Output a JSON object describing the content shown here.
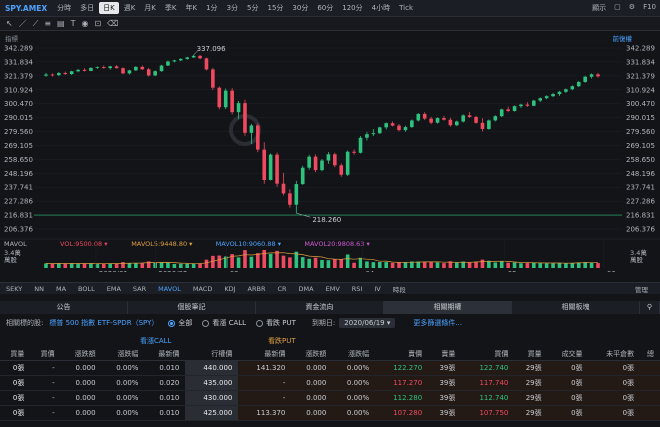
{
  "topbar": {
    "symbol": "SPY.AMEX",
    "periods": [
      "分時",
      "多日",
      "日K",
      "週K",
      "月K",
      "季K",
      "年K",
      "1分",
      "3分",
      "5分",
      "15分",
      "30分",
      "60分",
      "120分",
      "4小時",
      "Tick"
    ],
    "active_period": "日K",
    "right_items": [
      "顯示",
      "▢",
      "⚙",
      "F10"
    ]
  },
  "indicator_bar": {
    "left_label": "指標",
    "right_label": "前復權"
  },
  "chart_data": {
    "type": "candlestick",
    "price_ticks": [
      "342.289",
      "331.834",
      "321.379",
      "310.924",
      "300.470",
      "290.015",
      "279.560",
      "269.105",
      "258.650",
      "248.196",
      "237.741",
      "227.286",
      "216.831",
      "206.376"
    ],
    "ylim": [
      206.376,
      342.289
    ],
    "x_tick_labels": [
      "2020/01",
      "2020/02",
      "03",
      "04",
      "05",
      "06"
    ],
    "annotations": [
      {
        "label": "337.096",
        "value": 337.096
      },
      {
        "label": "218.260",
        "value": 218.26
      }
    ],
    "bars": [
      {
        "o": 321.5,
        "h": 323.6,
        "l": 320.7,
        "c": 322.4
      },
      {
        "o": 322.4,
        "h": 323.1,
        "l": 320.8,
        "c": 321.9
      },
      {
        "o": 321.9,
        "h": 324.3,
        "l": 321.2,
        "c": 323.5
      },
      {
        "o": 323.5,
        "h": 324.6,
        "l": 322.2,
        "c": 322.7
      },
      {
        "o": 322.7,
        "h": 325.2,
        "l": 322.1,
        "c": 324.8
      },
      {
        "o": 324.8,
        "h": 326.4,
        "l": 324.1,
        "c": 325.9
      },
      {
        "o": 325.9,
        "h": 327.1,
        "l": 324.6,
        "c": 325.1
      },
      {
        "o": 325.1,
        "h": 327.8,
        "l": 324.8,
        "c": 327.3
      },
      {
        "o": 327.3,
        "h": 328.5,
        "l": 326.6,
        "c": 327.9
      },
      {
        "o": 327.9,
        "h": 329.1,
        "l": 326.8,
        "c": 327.2
      },
      {
        "o": 327.2,
        "h": 328.9,
        "l": 326.1,
        "c": 328.5
      },
      {
        "o": 328.5,
        "h": 329.4,
        "l": 326.9,
        "c": 327.1
      },
      {
        "o": 327.1,
        "h": 327.8,
        "l": 322.6,
        "c": 323.2
      },
      {
        "o": 323.2,
        "h": 325.9,
        "l": 322.4,
        "c": 325.5
      },
      {
        "o": 325.5,
        "h": 328.7,
        "l": 325.1,
        "c": 328.1
      },
      {
        "o": 328.1,
        "h": 329.2,
        "l": 325.8,
        "c": 326.3
      },
      {
        "o": 326.3,
        "h": 327.4,
        "l": 320.9,
        "c": 321.7
      },
      {
        "o": 321.7,
        "h": 325.5,
        "l": 321.1,
        "c": 324.9
      },
      {
        "o": 324.9,
        "h": 329.6,
        "l": 324.5,
        "c": 329.1
      },
      {
        "o": 329.1,
        "h": 332.8,
        "l": 328.8,
        "c": 332.2
      },
      {
        "o": 332.2,
        "h": 333.4,
        "l": 331.5,
        "c": 333.0
      },
      {
        "o": 333.0,
        "h": 334.6,
        "l": 332.4,
        "c": 334.1
      },
      {
        "o": 334.1,
        "h": 335.7,
        "l": 333.4,
        "c": 335.2
      },
      {
        "o": 335.2,
        "h": 337.1,
        "l": 334.8,
        "c": 336.4
      },
      {
        "o": 336.4,
        "h": 337.0,
        "l": 333.9,
        "c": 334.5
      },
      {
        "o": 334.5,
        "h": 335.1,
        "l": 325.4,
        "c": 326.2
      },
      {
        "o": 326.2,
        "h": 327.3,
        "l": 310.7,
        "c": 312.5
      },
      {
        "o": 312.5,
        "h": 313.4,
        "l": 296.2,
        "c": 297.8
      },
      {
        "o": 297.8,
        "h": 311.9,
        "l": 296.4,
        "c": 310.3
      },
      {
        "o": 310.3,
        "h": 312.2,
        "l": 292.4,
        "c": 294.1
      },
      {
        "o": 294.1,
        "h": 302.6,
        "l": 288.8,
        "c": 300.9
      },
      {
        "o": 300.9,
        "h": 303.5,
        "l": 276.4,
        "c": 278.6
      },
      {
        "o": 278.6,
        "h": 285.3,
        "l": 270.2,
        "c": 284.1
      },
      {
        "o": 284.1,
        "h": 285.6,
        "l": 264.1,
        "c": 266.0
      },
      {
        "o": 266.0,
        "h": 271.5,
        "l": 240.3,
        "c": 243.2
      },
      {
        "o": 243.2,
        "h": 263.1,
        "l": 242.8,
        "c": 262.2
      },
      {
        "o": 262.2,
        "h": 263.8,
        "l": 238.1,
        "c": 240.4
      },
      {
        "o": 240.4,
        "h": 248.6,
        "l": 231.6,
        "c": 233.1
      },
      {
        "o": 233.1,
        "h": 236.2,
        "l": 222.4,
        "c": 224.6
      },
      {
        "o": 224.6,
        "h": 242.5,
        "l": 218.3,
        "c": 240.1
      },
      {
        "o": 240.1,
        "h": 253.8,
        "l": 239.5,
        "c": 252.4
      },
      {
        "o": 252.4,
        "h": 262.1,
        "l": 250.8,
        "c": 260.7
      },
      {
        "o": 260.7,
        "h": 262.4,
        "l": 249.1,
        "c": 250.6
      },
      {
        "o": 250.6,
        "h": 258.9,
        "l": 249.7,
        "c": 257.8
      },
      {
        "o": 257.8,
        "h": 264.1,
        "l": 255.3,
        "c": 262.5
      },
      {
        "o": 262.5,
        "h": 263.7,
        "l": 252.8,
        "c": 254.2
      },
      {
        "o": 254.2,
        "h": 255.6,
        "l": 245.6,
        "c": 247.1
      },
      {
        "o": 247.1,
        "h": 265.3,
        "l": 246.2,
        "c": 264.4
      },
      {
        "o": 264.4,
        "h": 266.2,
        "l": 262.1,
        "c": 263.6
      },
      {
        "o": 263.6,
        "h": 276.2,
        "l": 263.1,
        "c": 274.9
      },
      {
        "o": 274.9,
        "h": 279.3,
        "l": 272.8,
        "c": 277.6
      },
      {
        "o": 277.6,
        "h": 281.4,
        "l": 276.2,
        "c": 278.3
      },
      {
        "o": 278.3,
        "h": 283.2,
        "l": 277.8,
        "c": 282.7
      },
      {
        "o": 282.7,
        "h": 286.4,
        "l": 281.1,
        "c": 285.8
      },
      {
        "o": 285.8,
        "h": 287.1,
        "l": 283.4,
        "c": 284.0
      },
      {
        "o": 284.0,
        "h": 285.2,
        "l": 279.8,
        "c": 280.6
      },
      {
        "o": 280.6,
        "h": 283.9,
        "l": 279.4,
        "c": 282.9
      },
      {
        "o": 282.9,
        "h": 288.6,
        "l": 282.3,
        "c": 287.9
      },
      {
        "o": 287.9,
        "h": 293.4,
        "l": 287.1,
        "c": 292.8
      },
      {
        "o": 292.8,
        "h": 294.1,
        "l": 288.2,
        "c": 289.3
      },
      {
        "o": 289.3,
        "h": 290.6,
        "l": 285.1,
        "c": 286.2
      },
      {
        "o": 286.2,
        "h": 290.3,
        "l": 285.5,
        "c": 289.7
      },
      {
        "o": 289.7,
        "h": 291.2,
        "l": 287.8,
        "c": 288.4
      },
      {
        "o": 288.4,
        "h": 289.9,
        "l": 283.2,
        "c": 284.3
      },
      {
        "o": 284.3,
        "h": 287.8,
        "l": 283.6,
        "c": 287.1
      },
      {
        "o": 287.1,
        "h": 292.5,
        "l": 286.3,
        "c": 291.7
      },
      {
        "o": 291.7,
        "h": 294.2,
        "l": 289.8,
        "c": 290.5
      },
      {
        "o": 290.5,
        "h": 291.3,
        "l": 285.4,
        "c": 286.1
      },
      {
        "o": 286.1,
        "h": 289.5,
        "l": 279.7,
        "c": 281.5
      },
      {
        "o": 281.5,
        "h": 288.6,
        "l": 280.9,
        "c": 287.9
      },
      {
        "o": 287.9,
        "h": 291.8,
        "l": 287.2,
        "c": 291.1
      },
      {
        "o": 291.1,
        "h": 296.7,
        "l": 290.4,
        "c": 296.2
      },
      {
        "o": 296.2,
        "h": 298.3,
        "l": 294.1,
        "c": 295.0
      },
      {
        "o": 295.0,
        "h": 299.1,
        "l": 294.6,
        "c": 298.6
      },
      {
        "o": 298.6,
        "h": 300.4,
        "l": 297.2,
        "c": 299.8
      },
      {
        "o": 299.8,
        "h": 301.6,
        "l": 298.1,
        "c": 298.9
      },
      {
        "o": 298.9,
        "h": 303.4,
        "l": 298.6,
        "c": 302.8
      },
      {
        "o": 302.8,
        "h": 305.2,
        "l": 301.7,
        "c": 304.6
      },
      {
        "o": 304.6,
        "h": 306.8,
        "l": 303.9,
        "c": 306.1
      },
      {
        "o": 306.1,
        "h": 308.5,
        "l": 305.4,
        "c": 307.7
      },
      {
        "o": 307.7,
        "h": 310.1,
        "l": 306.2,
        "c": 309.4
      },
      {
        "o": 309.4,
        "h": 311.9,
        "l": 308.5,
        "c": 311.3
      },
      {
        "o": 311.3,
        "h": 314.2,
        "l": 310.6,
        "c": 313.6
      },
      {
        "o": 313.6,
        "h": 317.6,
        "l": 312.9,
        "c": 316.8
      },
      {
        "o": 316.8,
        "h": 321.4,
        "l": 316.1,
        "c": 320.7
      },
      {
        "o": 320.7,
        "h": 323.2,
        "l": 319.4,
        "c": 322.5
      },
      {
        "o": 322.5,
        "h": 323.6,
        "l": 320.1,
        "c": 321.0
      }
    ]
  },
  "volume": {
    "labels": [
      {
        "text": "MAVOL",
        "color": "#aeb3bb"
      },
      {
        "text": "VOL:9500.08 ▾",
        "color": "#ef4a5f"
      },
      {
        "text": "MAVOL5:9448.80 ▾",
        "color": "#e0a040"
      },
      {
        "text": "MAVOL10:9060.88 ▾",
        "color": "#4aa3ff"
      },
      {
        "text": "MAVOL20:9808.63 ▾",
        "color": "#d05ad0"
      }
    ],
    "left_tick": "3.4萬",
    "left_unit": "萬股",
    "right_tick": "3.4萬",
    "right_unit": "萬股"
  },
  "indicator_tabs": [
    "SEKY",
    "NN",
    "MA",
    "BOLL",
    "EMA",
    "SAR",
    "MAVOL",
    "MACD",
    "KDJ",
    "ARBR",
    "CR",
    "DMA",
    "EMV",
    "RSI",
    "IV",
    "時段"
  ],
  "indicator_active": "MAVOL",
  "indicator_manage": "管理",
  "panel_tabs": [
    "公告",
    "個股筆記",
    "資金流向",
    "相關期權",
    "相關板塊"
  ],
  "panel_active": "相關期權",
  "filter": {
    "label": "相關標的股:",
    "underlying": "標普 500 指數 ETF-SPDR（SPY）",
    "options": [
      {
        "label": "全部",
        "on": true
      },
      {
        "label": "看漲 CALL",
        "on": false
      },
      {
        "label": "看跌 PUT",
        "on": false
      }
    ],
    "expiry_label": "到期日:",
    "expiry_value": "2020/06/19 ▾",
    "more": "更多篩選條件..."
  },
  "groups": {
    "call": "看漲CALL",
    "put": "看跌PUT"
  },
  "table": {
    "headers": [
      "買量",
      "買價",
      "漲跌額",
      "漲跌幅",
      "最新價",
      "行權價",
      "最新價",
      "漲跌額",
      "漲跌幅",
      "賣價",
      "賣量",
      "買價",
      "買量",
      "成交量",
      "未平倉數",
      "總"
    ],
    "rows": [
      [
        "0張",
        "-",
        "0.000",
        "0.00%",
        "0.010",
        "440.000",
        "141.320",
        "0.000",
        "0.00%",
        "122.270",
        "39張",
        "122.740",
        "29張",
        "0張",
        "0張"
      ],
      [
        "0張",
        "-",
        "0.000",
        "0.00%",
        "0.020",
        "435.000",
        "-",
        "0.000",
        "0.00%",
        "117.270",
        "39張",
        "117.740",
        "29張",
        "0張",
        "0張"
      ],
      [
        "0張",
        "-",
        "0.000",
        "0.00%",
        "0.010",
        "430.000",
        "-",
        "0.000",
        "0.00%",
        "112.280",
        "39張",
        "112.740",
        "29張",
        "0張",
        "0張"
      ],
      [
        "0張",
        "-",
        "0.000",
        "0.00%",
        "0.010",
        "425.000",
        "113.370",
        "0.000",
        "0.00%",
        "107.280",
        "39張",
        "107.750",
        "29張",
        "0張",
        "0張"
      ]
    ]
  }
}
